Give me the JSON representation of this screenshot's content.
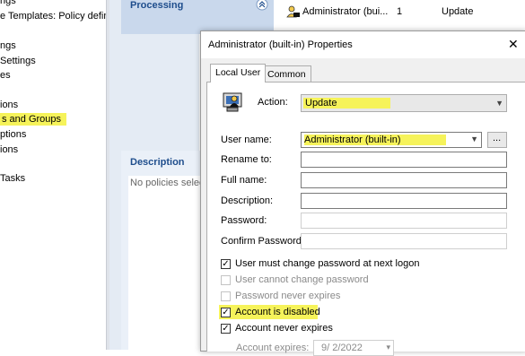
{
  "tree": {
    "items": [
      {
        "label": "ngs"
      },
      {
        "label": "e Templates: Policy defin"
      },
      {
        "label": "ngs"
      },
      {
        "label": "Settings"
      },
      {
        "label": "es"
      },
      {
        "label": "ions"
      },
      {
        "label": "s and Groups"
      },
      {
        "label": "ptions"
      },
      {
        "label": "ions"
      },
      {
        "label": "Tasks"
      }
    ]
  },
  "mid": {
    "processing": "Processing",
    "description": "Description",
    "no_policies": "No policies selec"
  },
  "list": {
    "row_name": "Administrator (bui...",
    "row_order": "1",
    "row_action": "Update"
  },
  "dialog": {
    "title": "Administrator (built-in) Properties",
    "close": "✕",
    "tabs": [
      "Local User",
      "Common"
    ],
    "action_label": "Action:",
    "action_value": "Update",
    "username_label": "User name:",
    "username_value": "Administrator (built-in)",
    "browse_label": "...",
    "rename_label": "Rename to:",
    "fullname_label": "Full name:",
    "description_label": "Description:",
    "password_label": "Password:",
    "confirm_label": "Confirm Password:",
    "checkboxes": [
      {
        "label": "User must change password at next logon",
        "checked": true,
        "enabled": true
      },
      {
        "label": "User cannot change password",
        "checked": false,
        "enabled": false
      },
      {
        "label": "Password never expires",
        "checked": false,
        "enabled": false
      },
      {
        "label": "Account is disabled",
        "checked": true,
        "enabled": true
      },
      {
        "label": "Account never expires",
        "checked": true,
        "enabled": true
      }
    ],
    "expires_label": "Account expires:",
    "expires_value": "9/ 2/2022"
  },
  "colors": {
    "highlight": "#f6f35a",
    "panel_title": "#1e4d8c"
  }
}
